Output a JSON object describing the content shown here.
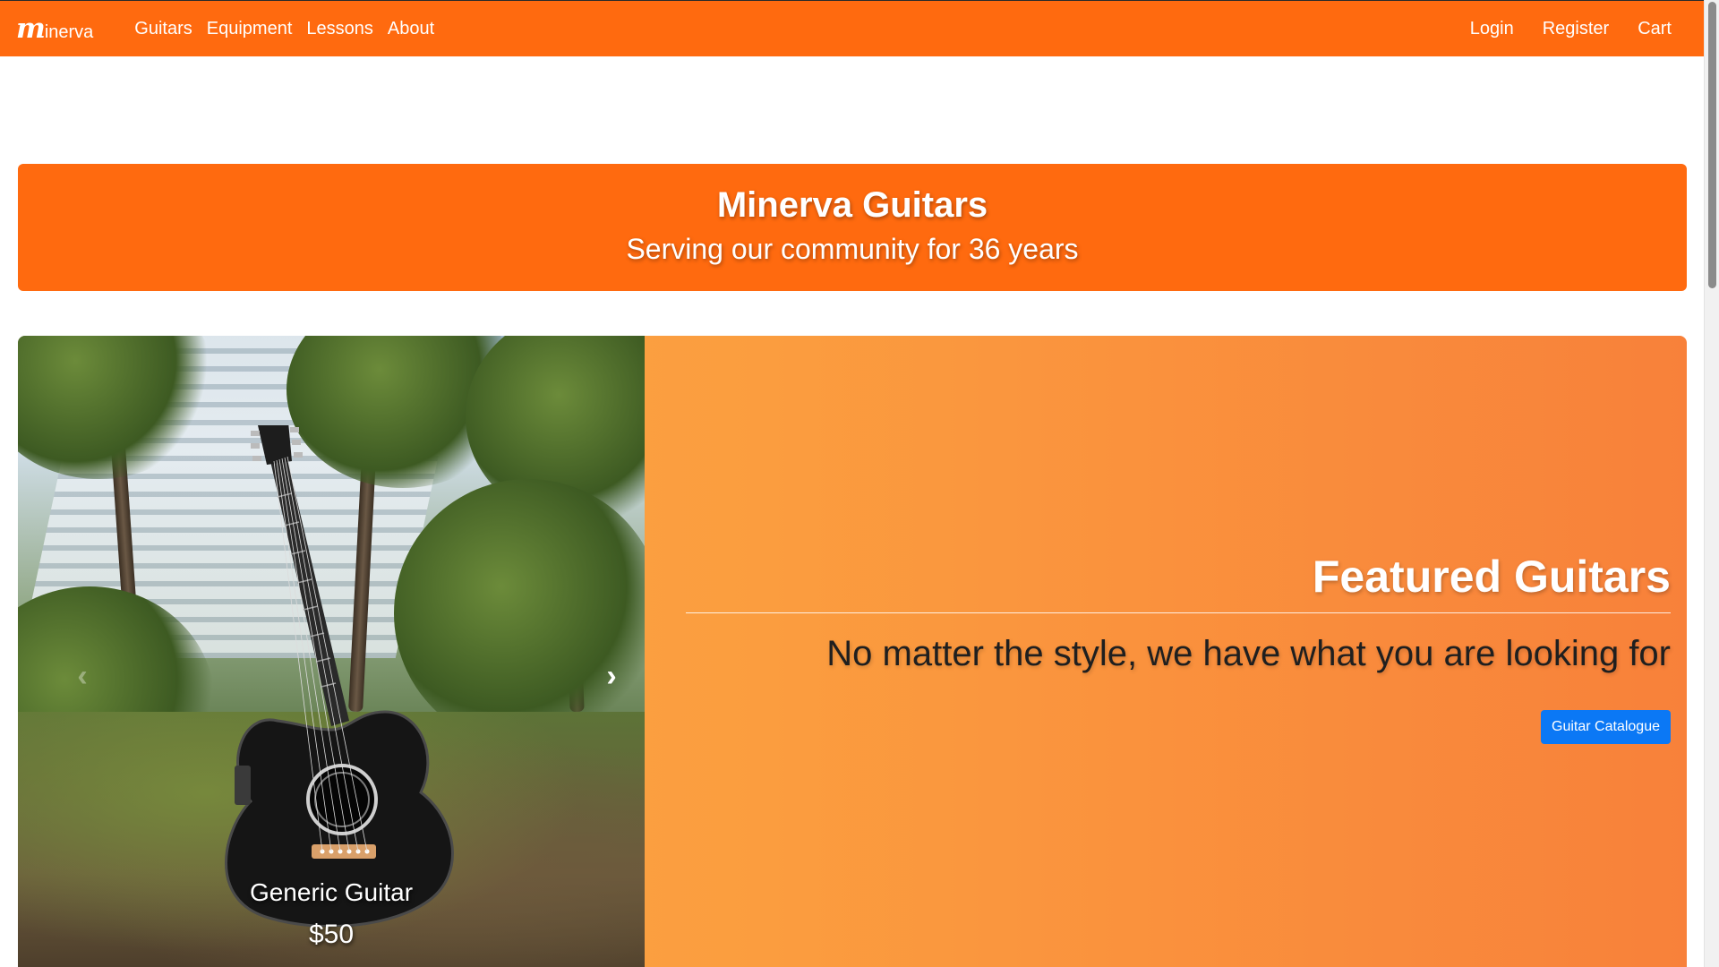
{
  "navbar": {
    "brand_mark": "m",
    "brand_text": "inerva",
    "left_links": [
      "Guitars",
      "Equipment",
      "Lessons",
      "About"
    ],
    "right_links": [
      "Login",
      "Register",
      "Cart"
    ],
    "background": "#ff6a0f"
  },
  "hero": {
    "title": "Minerva Guitars",
    "subtitle": "Serving our community for 36 years"
  },
  "carousel": {
    "caption_name": "Generic Guitar",
    "caption_price": "$50",
    "prev_icon": "‹",
    "next_icon": "›"
  },
  "featured": {
    "title": "Featured Guitars",
    "subtitle": "No matter the style, we have what you are looking for",
    "button_label": "Guitar Catalogue",
    "button_color": "#0b78f5"
  }
}
